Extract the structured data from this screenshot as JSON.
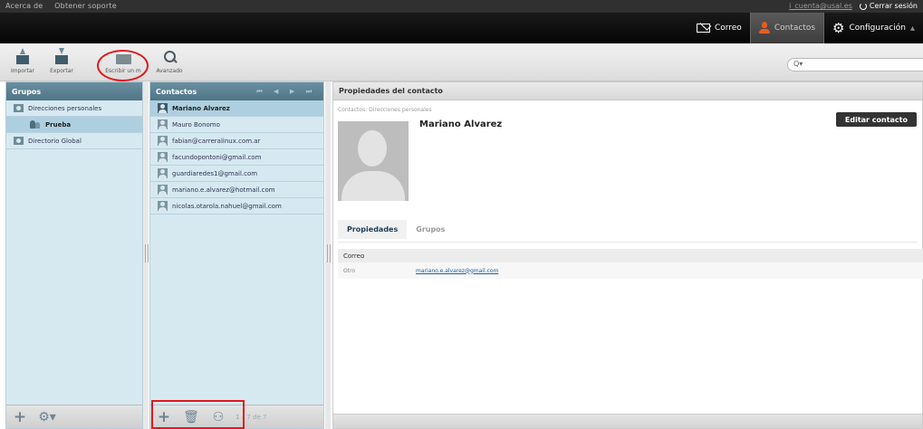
{
  "topbar": {
    "links": [
      "Acerca de",
      "Obtener soporte"
    ],
    "user": "i_cuenta@usal.es",
    "logout": "Cerrar sesión"
  },
  "taskbar": {
    "mail": "Correo",
    "contacts": "Contactos",
    "settings": "Configuración"
  },
  "toolbar": {
    "import": "Importar",
    "export": "Exportar",
    "compose": "Escribir un m",
    "advanced": "Avanzado",
    "search_prefix": "Q▾"
  },
  "groups": {
    "title": "Grupos",
    "items": [
      {
        "label": "Direcciones personales"
      },
      {
        "label": "Prueba"
      },
      {
        "label": "Directorio Global"
      }
    ]
  },
  "contacts": {
    "title": "Contactos",
    "pager": "⏮ ◀ ▶ ⏭",
    "items": [
      "Mariano Alvarez",
      "Mauro Bonomo",
      "fabian@carreralinux.com.ar",
      "facundopontoni@gmail.com",
      "guardiaredes1@gmail.com",
      "mariano.e.alvarez@hotmail.com",
      "nicolas.otarola.nahuel@gmail.com"
    ],
    "count": "1 – 7 de 7"
  },
  "properties": {
    "title": "Propiedades del contacto",
    "breadcrumb": "Contactos: Direcciones personales",
    "name": "Mariano Alvarez",
    "edit_button": "Editar contacto",
    "tabs": [
      "Propiedades",
      "Grupos"
    ],
    "section": "Correo",
    "field_label": "Otro",
    "field_value": "mariano.e.alvarez@gmail.com"
  },
  "colors": {
    "accent": "#e85c1f",
    "annotation": "#e0191c",
    "panel_header": "#5b8194"
  }
}
